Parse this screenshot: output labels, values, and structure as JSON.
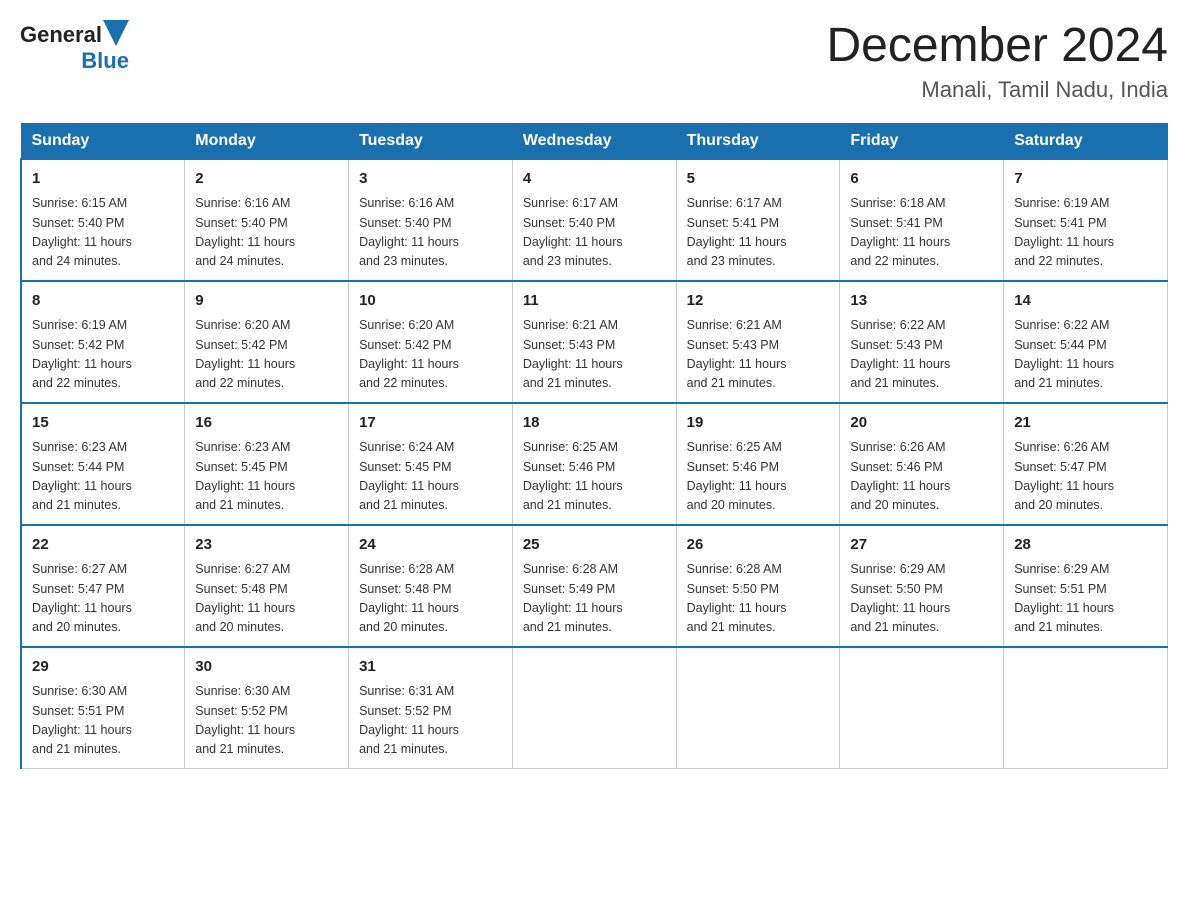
{
  "header": {
    "logo_general": "General",
    "logo_blue": "Blue",
    "month_year": "December 2024",
    "location": "Manali, Tamil Nadu, India"
  },
  "days_of_week": [
    "Sunday",
    "Monday",
    "Tuesday",
    "Wednesday",
    "Thursday",
    "Friday",
    "Saturday"
  ],
  "weeks": [
    [
      {
        "day": "1",
        "sunrise": "6:15 AM",
        "sunset": "5:40 PM",
        "daylight": "11 hours and 24 minutes."
      },
      {
        "day": "2",
        "sunrise": "6:16 AM",
        "sunset": "5:40 PM",
        "daylight": "11 hours and 24 minutes."
      },
      {
        "day": "3",
        "sunrise": "6:16 AM",
        "sunset": "5:40 PM",
        "daylight": "11 hours and 23 minutes."
      },
      {
        "day": "4",
        "sunrise": "6:17 AM",
        "sunset": "5:40 PM",
        "daylight": "11 hours and 23 minutes."
      },
      {
        "day": "5",
        "sunrise": "6:17 AM",
        "sunset": "5:41 PM",
        "daylight": "11 hours and 23 minutes."
      },
      {
        "day": "6",
        "sunrise": "6:18 AM",
        "sunset": "5:41 PM",
        "daylight": "11 hours and 22 minutes."
      },
      {
        "day": "7",
        "sunrise": "6:19 AM",
        "sunset": "5:41 PM",
        "daylight": "11 hours and 22 minutes."
      }
    ],
    [
      {
        "day": "8",
        "sunrise": "6:19 AM",
        "sunset": "5:42 PM",
        "daylight": "11 hours and 22 minutes."
      },
      {
        "day": "9",
        "sunrise": "6:20 AM",
        "sunset": "5:42 PM",
        "daylight": "11 hours and 22 minutes."
      },
      {
        "day": "10",
        "sunrise": "6:20 AM",
        "sunset": "5:42 PM",
        "daylight": "11 hours and 22 minutes."
      },
      {
        "day": "11",
        "sunrise": "6:21 AM",
        "sunset": "5:43 PM",
        "daylight": "11 hours and 21 minutes."
      },
      {
        "day": "12",
        "sunrise": "6:21 AM",
        "sunset": "5:43 PM",
        "daylight": "11 hours and 21 minutes."
      },
      {
        "day": "13",
        "sunrise": "6:22 AM",
        "sunset": "5:43 PM",
        "daylight": "11 hours and 21 minutes."
      },
      {
        "day": "14",
        "sunrise": "6:22 AM",
        "sunset": "5:44 PM",
        "daylight": "11 hours and 21 minutes."
      }
    ],
    [
      {
        "day": "15",
        "sunrise": "6:23 AM",
        "sunset": "5:44 PM",
        "daylight": "11 hours and 21 minutes."
      },
      {
        "day": "16",
        "sunrise": "6:23 AM",
        "sunset": "5:45 PM",
        "daylight": "11 hours and 21 minutes."
      },
      {
        "day": "17",
        "sunrise": "6:24 AM",
        "sunset": "5:45 PM",
        "daylight": "11 hours and 21 minutes."
      },
      {
        "day": "18",
        "sunrise": "6:25 AM",
        "sunset": "5:46 PM",
        "daylight": "11 hours and 21 minutes."
      },
      {
        "day": "19",
        "sunrise": "6:25 AM",
        "sunset": "5:46 PM",
        "daylight": "11 hours and 20 minutes."
      },
      {
        "day": "20",
        "sunrise": "6:26 AM",
        "sunset": "5:46 PM",
        "daylight": "11 hours and 20 minutes."
      },
      {
        "day": "21",
        "sunrise": "6:26 AM",
        "sunset": "5:47 PM",
        "daylight": "11 hours and 20 minutes."
      }
    ],
    [
      {
        "day": "22",
        "sunrise": "6:27 AM",
        "sunset": "5:47 PM",
        "daylight": "11 hours and 20 minutes."
      },
      {
        "day": "23",
        "sunrise": "6:27 AM",
        "sunset": "5:48 PM",
        "daylight": "11 hours and 20 minutes."
      },
      {
        "day": "24",
        "sunrise": "6:28 AM",
        "sunset": "5:48 PM",
        "daylight": "11 hours and 20 minutes."
      },
      {
        "day": "25",
        "sunrise": "6:28 AM",
        "sunset": "5:49 PM",
        "daylight": "11 hours and 21 minutes."
      },
      {
        "day": "26",
        "sunrise": "6:28 AM",
        "sunset": "5:50 PM",
        "daylight": "11 hours and 21 minutes."
      },
      {
        "day": "27",
        "sunrise": "6:29 AM",
        "sunset": "5:50 PM",
        "daylight": "11 hours and 21 minutes."
      },
      {
        "day": "28",
        "sunrise": "6:29 AM",
        "sunset": "5:51 PM",
        "daylight": "11 hours and 21 minutes."
      }
    ],
    [
      {
        "day": "29",
        "sunrise": "6:30 AM",
        "sunset": "5:51 PM",
        "daylight": "11 hours and 21 minutes."
      },
      {
        "day": "30",
        "sunrise": "6:30 AM",
        "sunset": "5:52 PM",
        "daylight": "11 hours and 21 minutes."
      },
      {
        "day": "31",
        "sunrise": "6:31 AM",
        "sunset": "5:52 PM",
        "daylight": "11 hours and 21 minutes."
      },
      null,
      null,
      null,
      null
    ]
  ],
  "labels": {
    "sunrise": "Sunrise:",
    "sunset": "Sunset:",
    "daylight": "Daylight:"
  }
}
